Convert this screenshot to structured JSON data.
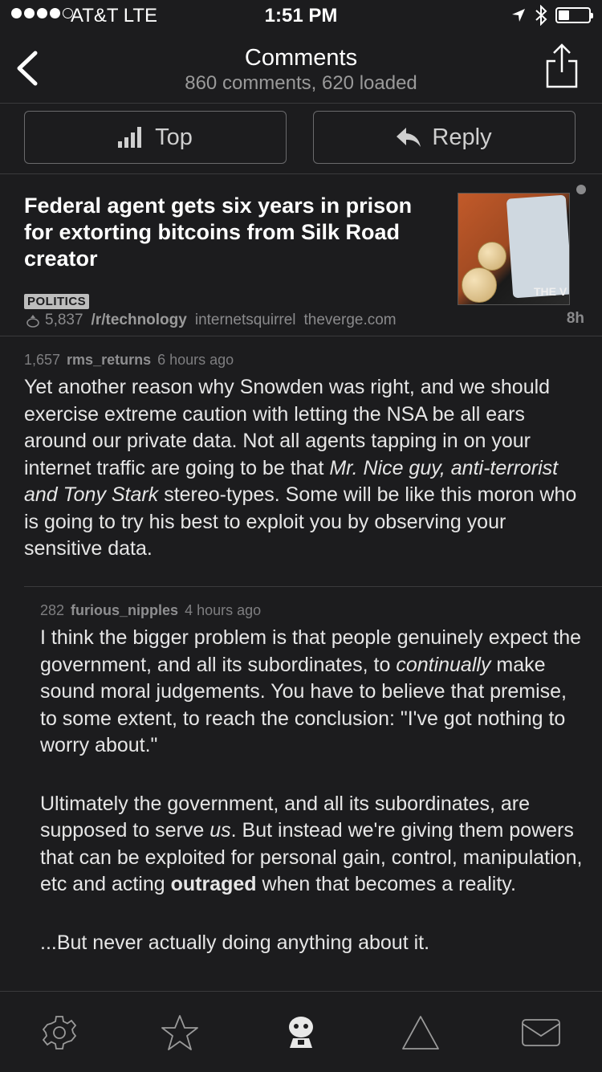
{
  "status_bar": {
    "carrier": "AT&T  LTE",
    "time": "1:51 PM",
    "icons": [
      "location-arrow-icon",
      "bluetooth-icon",
      "battery-icon"
    ],
    "battery_level": 0.35
  },
  "nav": {
    "title": "Comments",
    "subtitle": "860 comments, 620 loaded",
    "back_icon": "chevron-left-icon",
    "share_icon": "share-icon"
  },
  "actions": {
    "sort_label": "Top",
    "sort_icon": "bar-chart-icon",
    "reply_label": "Reply",
    "reply_icon": "reply-arrow-icon"
  },
  "post": {
    "title": "Federal agent gets six years in prison for extorting bitcoins from Silk Road creator",
    "flair": "POLITICS",
    "score": "5,837",
    "subreddit": "/r/technology",
    "author": "internetsquirrel",
    "domain": "theverge.com",
    "age": "8h",
    "thumbnail_text": "THE V"
  },
  "comments": [
    {
      "score": "1,657",
      "author": "rms_returns",
      "time": "6 hours ago",
      "body_1": "Yet another reason why Snowden was right, and we should exercise extreme caution with letting the NSA be all ears around our private data. Not all agents tapping in on your internet traffic are going to be that ",
      "body_italic_1": "Mr. Nice guy, anti-terrorist and  Tony Stark",
      "body_2": " stereo-types. Some will be like this moron who is going to try his best to exploit you by observing your sensitive data."
    },
    {
      "score": "282",
      "author": "furious_nipples",
      "time": "4 hours ago",
      "p1_a": "I think the bigger problem is that people genuinely expect the government, and all its subordinates, to ",
      "p1_italic": "continually",
      "p1_b": " make sound moral judgements.  You have to believe that premise, to some extent, to reach the conclusion: \"I've got nothing to worry about.\"",
      "p2_a": "Ultimately the government, and all its subordinates, are supposed to serve ",
      "p2_italic": "us",
      "p2_b": ".  But instead we're giving them powers that can be exploited for personal gain, control, manipulation, etc and acting ",
      "p2_bold": "outraged",
      "p2_c": " when that becomes a reality.",
      "p3": "...But never actually doing anything about it."
    }
  ],
  "tab_bar": {
    "tabs": [
      "settings-gear-icon",
      "favorites-star-icon",
      "reddit-alien-icon",
      "warning-triangle-icon",
      "inbox-mail-icon"
    ]
  }
}
